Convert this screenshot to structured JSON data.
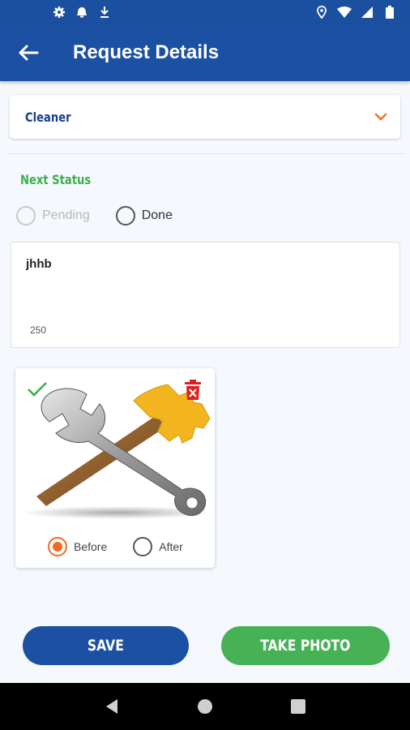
{
  "status_bar": {
    "left_icons": [
      "gear-icon",
      "alarm-icon",
      "download-icon"
    ],
    "right_icons": [
      "location-icon",
      "wifi-icon",
      "signal-icon",
      "battery-icon"
    ]
  },
  "app_bar": {
    "title": "Request Details",
    "back_icon": "arrow-left-icon",
    "color": "#1c50a3"
  },
  "service_dropdown": {
    "value": "Cleaner",
    "icon": "chevron-down-icon",
    "accent": "#f06a23"
  },
  "next_status": {
    "label": "Next Status",
    "color": "#3bb04a",
    "options": [
      {
        "label": "Pending",
        "selected": false,
        "enabled": false
      },
      {
        "label": "Done",
        "selected": false,
        "enabled": true
      }
    ]
  },
  "comment": {
    "value": "jhhb",
    "remaining": "250"
  },
  "photo_card": {
    "image": "tools-icon",
    "status_icon": "check-icon",
    "delete_icon": "trash-icon",
    "options": [
      {
        "label": "Before",
        "selected": true
      },
      {
        "label": "After",
        "selected": false
      }
    ]
  },
  "actions": {
    "save_label": "SAVE",
    "take_photo_label": "TAKE PHOTO",
    "save_color": "#1c50a3",
    "take_photo_color": "#46b255"
  },
  "nav_bar": {
    "buttons": [
      "back-triangle-icon",
      "home-circle-icon",
      "recents-square-icon"
    ]
  }
}
